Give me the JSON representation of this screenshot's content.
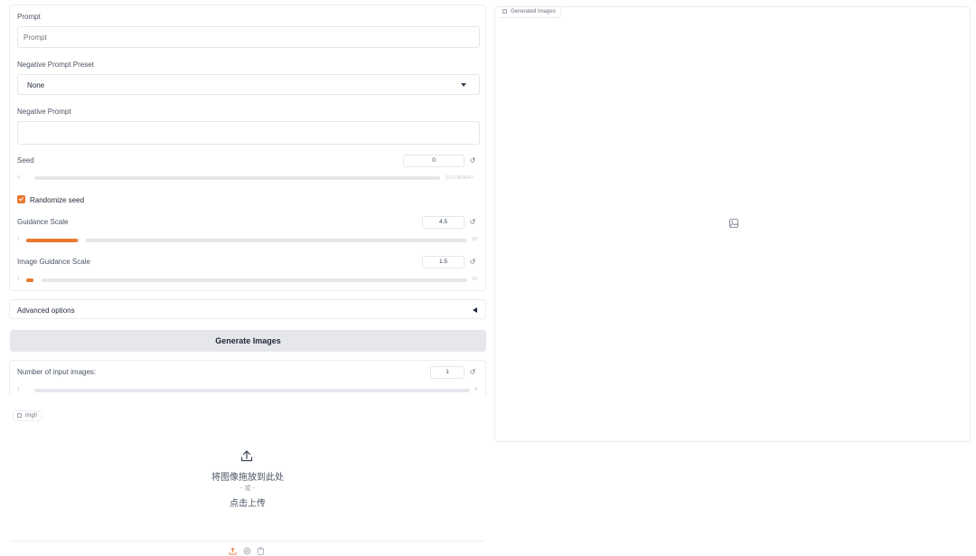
{
  "params": {
    "prompt": {
      "label": "Prompt",
      "placeholder": "Prompt",
      "value": ""
    },
    "negative_preset": {
      "label": "Negative Prompt Preset",
      "value": "None"
    },
    "negative_prompt": {
      "label": "Negative Prompt",
      "value": ""
    },
    "seed": {
      "label": "Seed",
      "value": "0",
      "min": "0",
      "max": "2147483647",
      "level": 0.0
    },
    "randomize_seed": {
      "label": "Randomize seed",
      "checked": true
    },
    "guidance_scale": {
      "label": "Guidance Scale",
      "value": "4.5",
      "min": "1",
      "max": "30",
      "level": 0.12
    },
    "image_guidance_scale": {
      "label": "Image Guidance Scale",
      "value": "1.5",
      "min": "1",
      "max": "30",
      "level": 0.017
    }
  },
  "advanced": {
    "label": "Advanced options"
  },
  "generate_button": {
    "label": "Generate Images"
  },
  "num_input_images": {
    "label": "Number of input images:",
    "value": "1",
    "min": "1",
    "max": "4",
    "level": 0.0
  },
  "upload": {
    "chip_label": "img0",
    "drop_text": "将图像拖放到此处",
    "or_text": "- 或 -",
    "click_text": "点击上传"
  },
  "output": {
    "chip_label": "Generated Images"
  },
  "icons": {
    "reset": "reset-icon",
    "upload": "upload-icon",
    "webcam": "webcam-icon",
    "clipboard": "clipboard-icon",
    "image_placeholder": "image-icon"
  },
  "colors": {
    "accent": "#e8772e",
    "button_bg": "#e5e7eb"
  }
}
